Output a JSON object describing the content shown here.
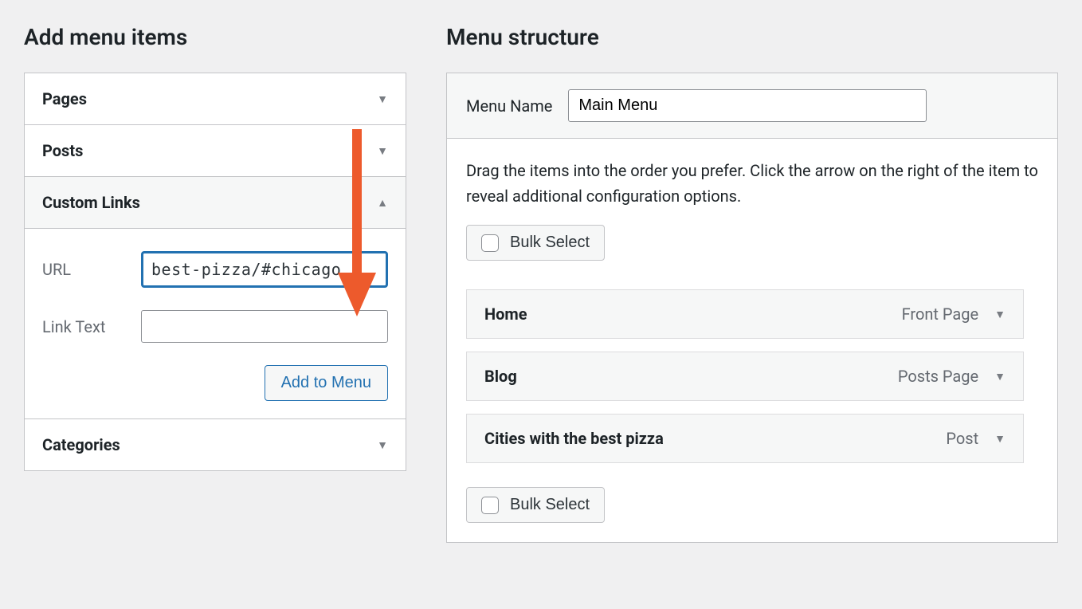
{
  "left": {
    "heading": "Add menu items",
    "accordion": [
      {
        "title": "Pages",
        "expanded": false
      },
      {
        "title": "Posts",
        "expanded": false
      },
      {
        "title": "Custom Links",
        "expanded": true
      },
      {
        "title": "Categories",
        "expanded": false
      }
    ],
    "custom_links": {
      "url_label": "URL",
      "url_value": "best-pizza/#chicago",
      "link_text_label": "Link Text",
      "link_text_value": "",
      "add_button": "Add to Menu"
    }
  },
  "right": {
    "heading": "Menu structure",
    "menu_name_label": "Menu Name",
    "menu_name_value": "Main Menu",
    "instructions": "Drag the items into the order you prefer. Click the arrow on the right of the item to reveal additional configuration options.",
    "bulk_select": "Bulk Select",
    "items": [
      {
        "label": "Home",
        "type": "Front Page"
      },
      {
        "label": "Blog",
        "type": "Posts Page"
      },
      {
        "label": "Cities with the best pizza",
        "type": "Post"
      }
    ]
  }
}
